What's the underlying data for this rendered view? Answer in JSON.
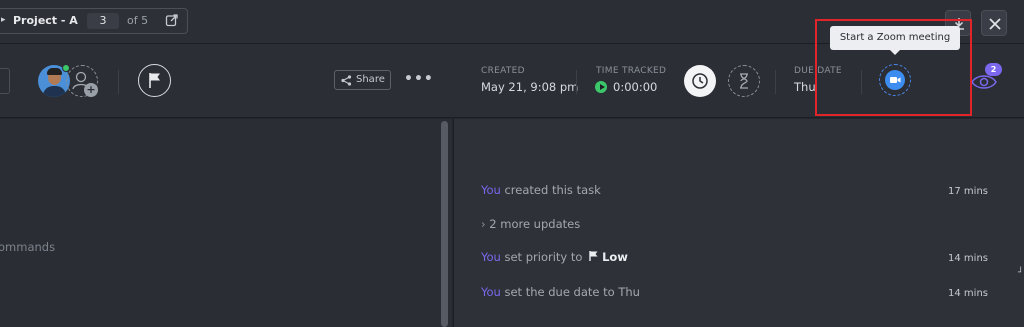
{
  "topbar": {
    "project_name": "Project - A",
    "page_current": "3",
    "page_total_text": "of 5"
  },
  "toolbar": {
    "share_label": "Share",
    "more_label": "•••",
    "created_label": "CREATED",
    "created_value": "May 21, 9:08 pm",
    "time_tracked_label": "TIME TRACKED",
    "time_tracked_value": "0:00:00",
    "due_date_label": "DUE DATE",
    "due_date_value": "Thu",
    "watchers_count": "2",
    "tooltip": "Start a Zoom meeting"
  },
  "left_pane": {
    "commands_hint": "ommands"
  },
  "activity": [
    {
      "who": "You",
      "text": " created this task",
      "time": "17 mins"
    },
    {
      "who": "",
      "text": "2 more updates",
      "time": ""
    },
    {
      "who": "You",
      "text": " set priority to ",
      "priority": "Low",
      "time": "14 mins"
    },
    {
      "who": "You",
      "text": " set the due date to Thu",
      "time": "14 mins"
    }
  ],
  "colors": {
    "accent": "#7b68ee",
    "zoom": "#3d8cf0",
    "highlight": "#e0242a",
    "online": "#3cc86a"
  }
}
